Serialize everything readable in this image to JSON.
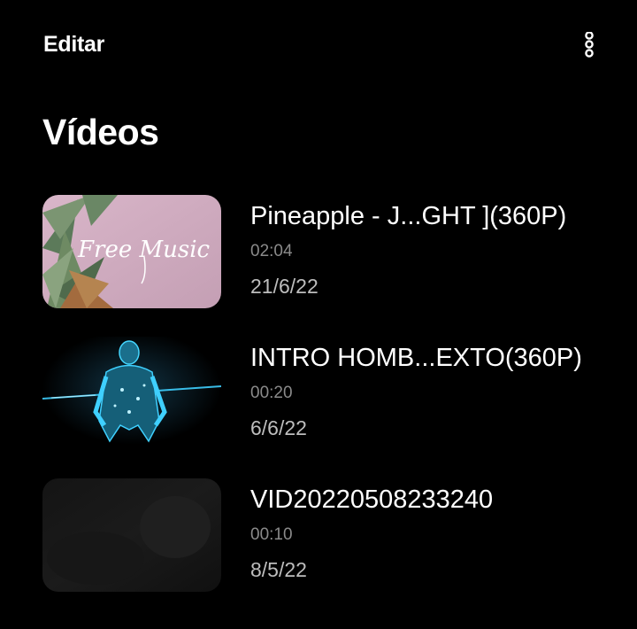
{
  "header": {
    "edit_label": "Editar",
    "more_icon": "more-vertical-icon"
  },
  "page": {
    "title": "Vídeos"
  },
  "videos": [
    {
      "title": "Pineapple - J...GHT ](360P)",
      "duration": "02:04",
      "date": "21/6/22",
      "thumbnail_text": "Free Music",
      "thumbnail_icon": "pineapple-leaves-thumbnail"
    },
    {
      "title": "INTRO HOMB...EXTO(360P)",
      "duration": "00:20",
      "date": "6/6/22",
      "thumbnail_icon": "glowing-figure-thumbnail"
    },
    {
      "title": "VID20220508233240",
      "duration": "00:10",
      "date": "8/5/22",
      "thumbnail_icon": "dark-scene-thumbnail"
    }
  ],
  "colors": {
    "background": "#000000",
    "primary_text": "#ffffff",
    "duration_text": "#8a8a8a",
    "date_text": "#bdbdbd",
    "accent_glow": "#3fd0ff"
  }
}
